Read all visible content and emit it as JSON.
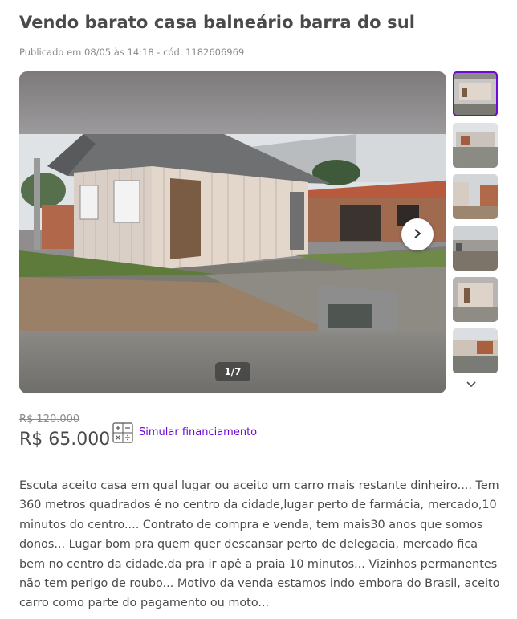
{
  "listing": {
    "title": "Vendo barato casa balneário barra do sul",
    "meta": "Publicado em 08/05 às 14:18 - cód. 1182606969"
  },
  "gallery": {
    "counter": "1/7",
    "next_icon": "chevron-right-icon",
    "thumbnail_count": 6,
    "more_icon": "chevron-down-icon"
  },
  "pricing": {
    "old_price": "R$ 120.000",
    "price": "R$ 65.000",
    "finance_label": "Simular financiamento",
    "finance_icon": "calculator-icon"
  },
  "description": {
    "text": "Escuta aceito casa em qual lugar ou aceito um carro mais restante dinheiro.... Tem 360 metros quadrados é no centro da cidade,lugar perto de farmácia, mercado,10 minutos do centro.... Contrato de compra e venda, tem mais30 anos que somos donos... Lugar bom pra quem quer descansar perto de delegacia, mercado fica bem no centro da cidade,da pra ir apê a praia 10 minutos... Vizinhos permanentes não tem perigo de roubo... Motivo da venda estamos indo embora do Brasil, aceito carro como parte do pagamento ou moto..."
  },
  "colors": {
    "accent": "#6e0ad6",
    "text": "#4a4a4a",
    "muted": "#8a8a8a"
  }
}
